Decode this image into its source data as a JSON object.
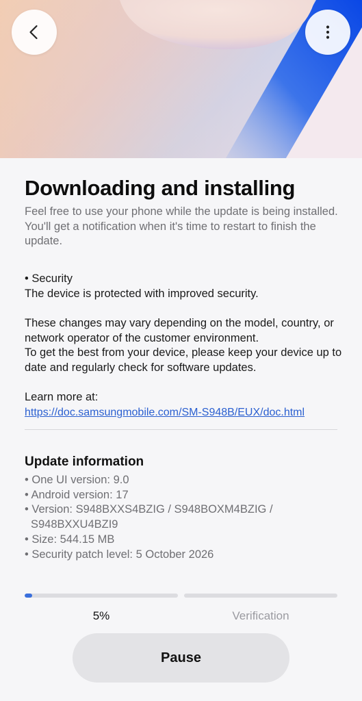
{
  "header": {
    "back_icon": "chevron-left-icon",
    "more_icon": "more-vertical-icon"
  },
  "main": {
    "title": "Downloading and installing",
    "subtitle": "Feel free to use your phone while the update is being installed. You'll get a notification when it's time to restart to finish the update.",
    "section_heading": "• Security",
    "section_body": "The device is protected with improved security.",
    "disclaimer_1": "These changes may vary depending on the model, country, or network operator of the customer environment.",
    "disclaimer_2": "To get the best from your device, please keep your device up to date and regularly check for software updates.",
    "learn_more_label": "Learn more at:",
    "learn_more_link": "https://doc.samsungmobile.com/SM-S948B/EUX/doc.html"
  },
  "update_info": {
    "title": "Update information",
    "one_ui": "• One UI version: 9.0",
    "android": "• Android version: 17",
    "version_line1": "• Version: S948BXXS4BZIG / S948BOXM4BZIG /",
    "version_line2": "S948BXXU4BZI9",
    "size": "• Size: 544.15 MB",
    "security_patch": "• Security patch level: 5 October 2026"
  },
  "progress": {
    "download_percent": 5,
    "download_label": "5%",
    "verification_label": "Verification",
    "accent_color": "#3a6fdc"
  },
  "actions": {
    "pause_label": "Pause"
  }
}
